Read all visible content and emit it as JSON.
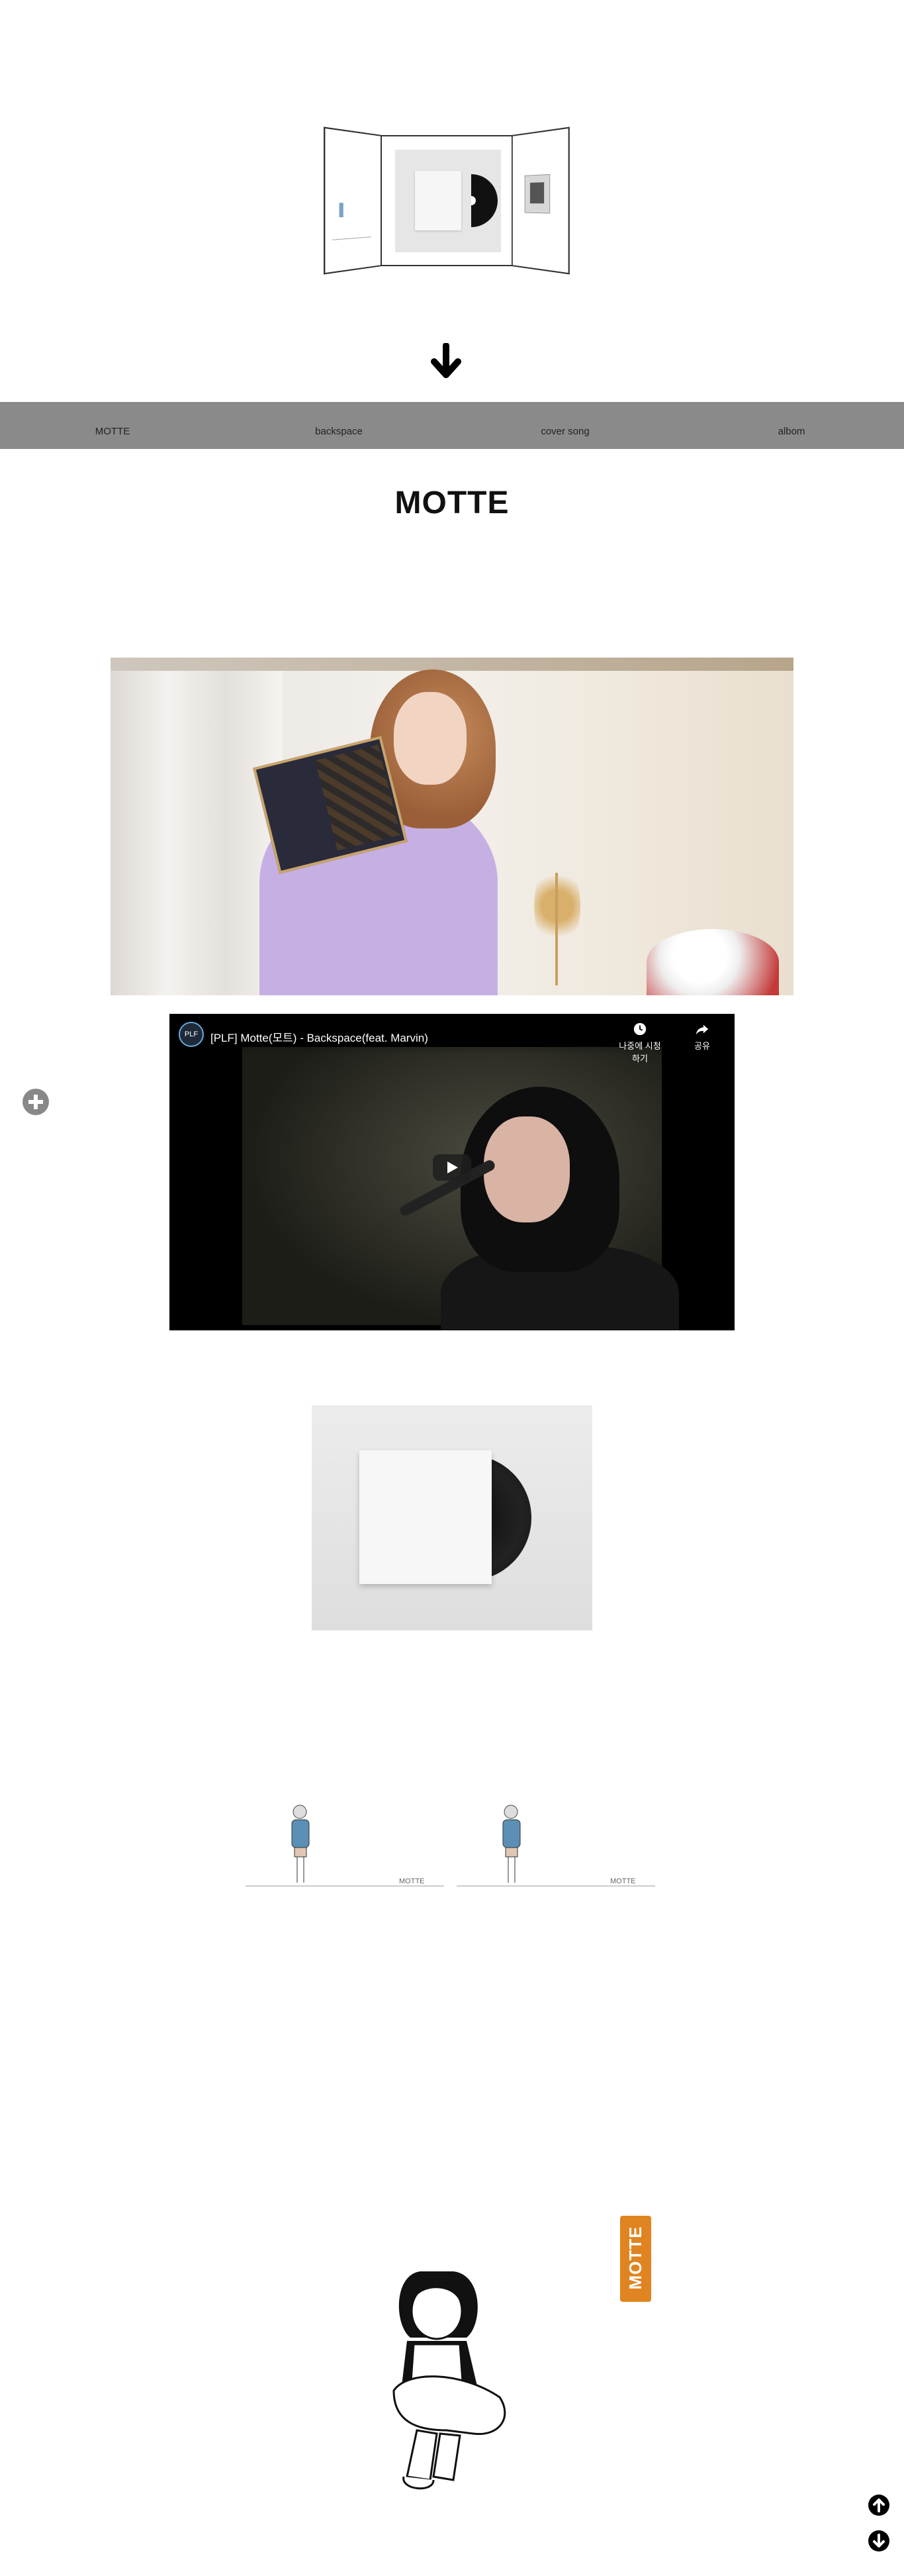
{
  "nav": {
    "items": [
      {
        "label": "MOTTE"
      },
      {
        "label": "backspace"
      },
      {
        "label": "cover song"
      },
      {
        "label": "albom"
      }
    ]
  },
  "section": {
    "title": "MOTTE"
  },
  "video": {
    "channel_logo_text": "PLF",
    "title": "[PLF] Motte(모트) - Backspace(feat. Marvin)",
    "watch_later_label": "나중에 시청하기",
    "share_label": "공유"
  },
  "figures": {
    "caption": "MOTTE"
  },
  "badge": {
    "text": "MOTTE",
    "color": "#e08421"
  },
  "icons": {
    "down_arrow": "arrow-down-icon",
    "plus": "plus-circle-icon",
    "scroll_up": "arrow-up-circle-icon",
    "scroll_down": "arrow-down-circle-icon",
    "clock": "clock-icon",
    "share": "share-icon",
    "play": "play-icon"
  },
  "colors": {
    "nav_bg": "#8a8a8a",
    "accent": "#e08421"
  }
}
